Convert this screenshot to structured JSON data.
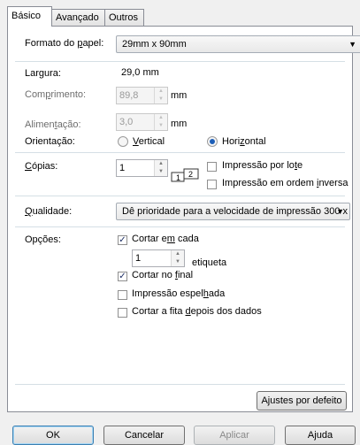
{
  "tabs": [
    {
      "label": "Básico",
      "active": true
    },
    {
      "label": "Avançado",
      "active": false
    },
    {
      "label": "Outros",
      "active": false
    }
  ],
  "paper_format": {
    "label_pre": "Formato do ",
    "label_u": "p",
    "label_post": "apel:",
    "value": "29mm x 90mm"
  },
  "width": {
    "label": "Largura:",
    "value": "29,0 mm"
  },
  "length": {
    "label_pre": "Com",
    "label_u": "p",
    "label_post": "rimento:",
    "value": "89,8",
    "unit": "mm"
  },
  "feed": {
    "label_pre": "Alimen",
    "label_u": "t",
    "label_post": "ação:",
    "value": "3,0",
    "unit": "mm"
  },
  "orientation": {
    "label": "Orientação:",
    "vertical": {
      "u": "V",
      "rest": "ertical",
      "selected": false
    },
    "horizontal": {
      "pre": "Hori",
      "u": "z",
      "rest": "ontal",
      "selected": true
    }
  },
  "copies": {
    "label_u": "C",
    "label_rest": "ópias:",
    "value": "1"
  },
  "batch_print": {
    "pre": "Impressão por lo",
    "u": "t",
    "post": "e",
    "checked": false
  },
  "reverse_print": {
    "pre": "Impressão em ordem ",
    "u": "i",
    "post": "nversa",
    "checked": false
  },
  "quality": {
    "label_u": "Q",
    "label_rest": "ualidade:",
    "value": "Dê prioridade para a velocidade de impressão 300 x"
  },
  "options": {
    "label": "Opções:",
    "cut_each": {
      "pre": "Cortar e",
      "u": "m",
      "post": " cada",
      "checked": true
    },
    "cut_count": "1",
    "label_unit": "etiqueta",
    "cut_end": {
      "pre": "Cortar no ",
      "u": "f",
      "post": "inal",
      "checked": true
    },
    "mirror": {
      "pre": "Impressão espel",
      "u": "h",
      "post": "ada",
      "checked": false
    },
    "cut_after": {
      "pre": "Cortar a fita ",
      "u": "d",
      "post": "epois dos dados",
      "checked": false
    }
  },
  "defaults_button": "Ajustes por defeito",
  "footer": {
    "ok": "OK",
    "cancel": "Cancelar",
    "apply": "Aplicar",
    "help": "Ajuda"
  },
  "icons": {
    "copies_icon": "collate-copies-icon",
    "check": "✓"
  }
}
